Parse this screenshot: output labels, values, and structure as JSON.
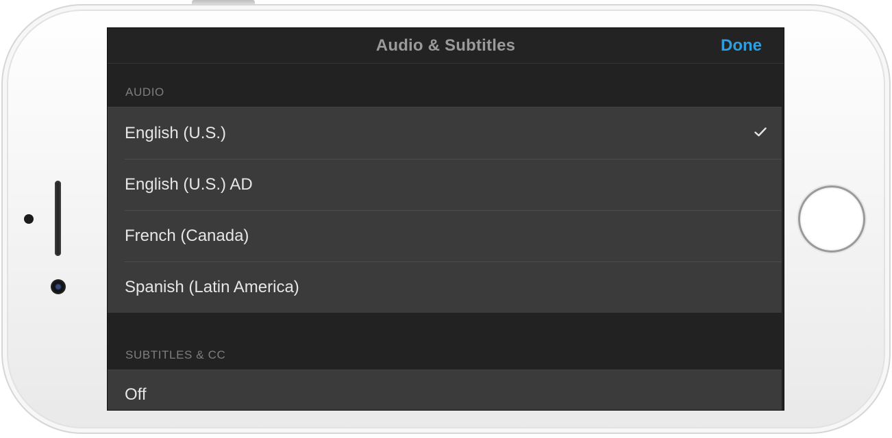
{
  "navbar": {
    "title": "Audio & Subtitles",
    "done_label": "Done"
  },
  "audio": {
    "header": "AUDIO",
    "items": [
      {
        "label": "English (U.S.)",
        "selected": true
      },
      {
        "label": "English (U.S.) AD",
        "selected": false
      },
      {
        "label": "French (Canada)",
        "selected": false
      },
      {
        "label": "Spanish (Latin America)",
        "selected": false
      }
    ]
  },
  "subtitles": {
    "header": "SUBTITLES & CC",
    "items": [
      {
        "label": "Off"
      }
    ]
  },
  "colors": {
    "accent": "#2d9fe0",
    "screen_bg": "#222222",
    "row_bg": "#3b3b3b"
  },
  "icons": {
    "selected_marker": "checkmark-icon"
  }
}
